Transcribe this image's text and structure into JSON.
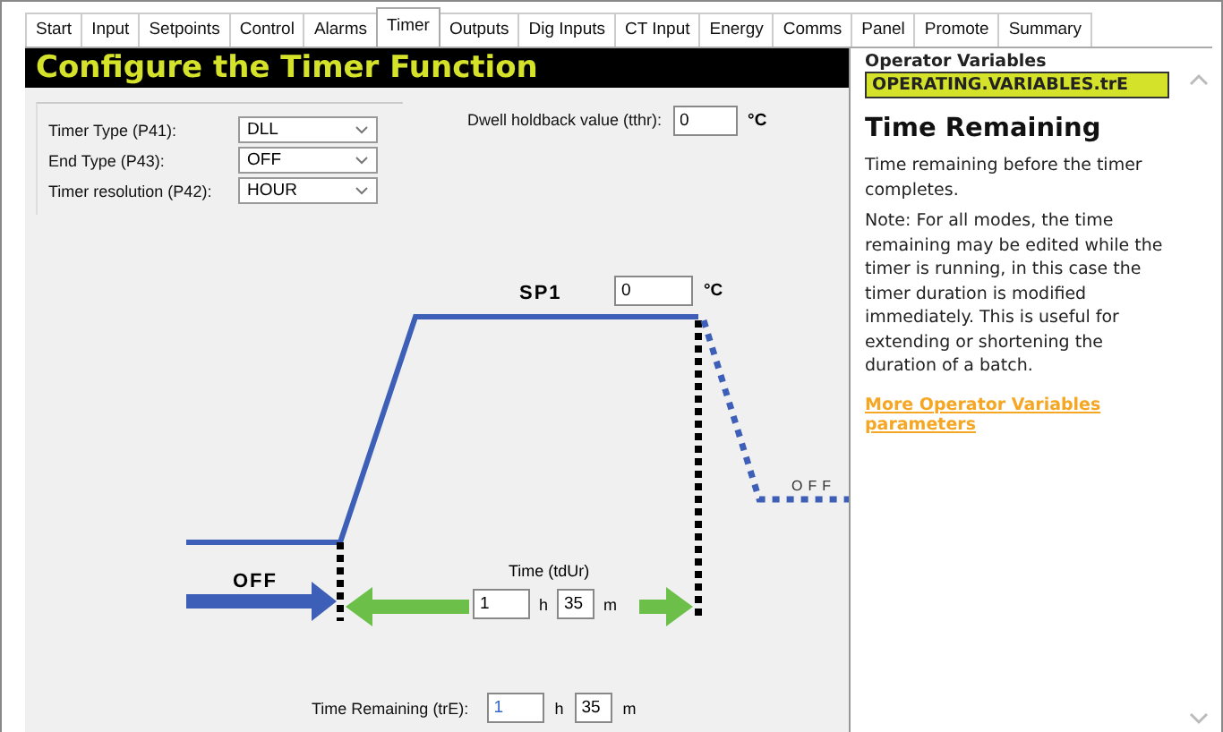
{
  "tabs": [
    {
      "label": "Start",
      "selected": false
    },
    {
      "label": "Input",
      "selected": false
    },
    {
      "label": "Setpoints",
      "selected": false
    },
    {
      "label": "Control",
      "selected": false
    },
    {
      "label": "Alarms",
      "selected": false
    },
    {
      "label": "Timer",
      "selected": true
    },
    {
      "label": "Outputs",
      "selected": false
    },
    {
      "label": "Dig Inputs",
      "selected": false
    },
    {
      "label": "CT Input",
      "selected": false
    },
    {
      "label": "Energy",
      "selected": false
    },
    {
      "label": "Comms",
      "selected": false
    },
    {
      "label": "Panel",
      "selected": false
    },
    {
      "label": "Promote",
      "selected": false
    },
    {
      "label": "Summary",
      "selected": false
    }
  ],
  "title": "Configure the Timer Function",
  "settings": [
    {
      "label": "Timer Type (P41):",
      "value": "DLL"
    },
    {
      "label": "End Type (P43):",
      "value": "OFF"
    },
    {
      "label": "Timer resolution (P42):",
      "value": "HOUR"
    }
  ],
  "dwell": {
    "label": "Dwell holdback value (tthr):",
    "value": "0",
    "unit": "°C"
  },
  "diagram": {
    "sp_label": "SP1",
    "sp_value": "0",
    "sp_unit": "°C",
    "start_label": "OFF",
    "end_label": "OFF",
    "duration": {
      "label": "Time (tdUr)",
      "hours": "1",
      "h_unit": "h",
      "minutes": "35",
      "m_unit": "m"
    }
  },
  "remaining": {
    "label": "Time Remaining (trE):",
    "hours": "1",
    "h_unit": "h",
    "minutes": "35",
    "m_unit": "m"
  },
  "help": {
    "section": "Operator Variables",
    "variable": "OPERATING.VARIABLES.trE",
    "heading": "Time Remaining",
    "paragraphs": [
      "Time remaining before the timer completes.",
      "Note: For all modes, the time remaining may be edited while the timer is running, in this case the timer duration is modified immediately. This is useful for extending or shortening the duration of a batch."
    ],
    "link": "More Operator Variables parameters"
  }
}
